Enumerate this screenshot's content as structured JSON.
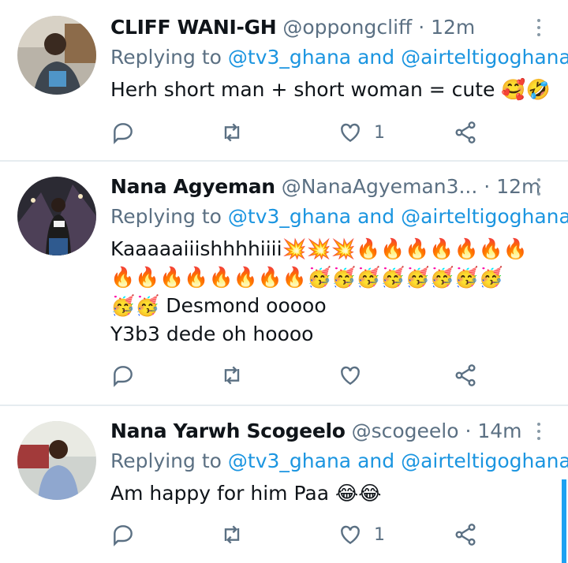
{
  "tweets": [
    {
      "name": "CLIFF WANI-GH",
      "handle": "@oppongcliff",
      "dot": "·",
      "time": "12m",
      "replying_prefix": "Replying to",
      "mention1": "@tv3_ghana",
      "and_word": "and",
      "mention2": "@airteltigoghana",
      "lines": [
        "Herh short man + short woman = cute 🥰🤣"
      ],
      "like_count": "1"
    },
    {
      "name": "Nana Agyeman",
      "handle": "@NanaAgyeman3...",
      "dot": "·",
      "time": "12m",
      "replying_prefix": "Replying to",
      "mention1": "@tv3_ghana",
      "and_word": "and",
      "mention2": "@airteltigoghana",
      "lines": [
        "Kaaaaaiiishhhhiiii💥💥💥🔥🔥🔥🔥🔥🔥🔥",
        "🔥🔥🔥🔥🔥🔥🔥🔥🥳🥳🥳🥳🥳🥳🥳🥳",
        "🥳🥳 Desmond ooooo",
        "Y3b3 dede oh hoooo"
      ],
      "like_count": ""
    },
    {
      "name": "Nana Yarwh Scogeelo",
      "handle": "@scogeelo",
      "dot": "·",
      "time": "14m",
      "replying_prefix": "Replying to",
      "mention1": "@tv3_ghana",
      "and_word": "and",
      "mention2": "@airteltigoghana",
      "lines": [
        "Am happy for him Paa 😂😂"
      ],
      "like_count": "1"
    }
  ],
  "icons": {
    "reply": "reply-icon",
    "retweet": "retweet-icon",
    "like": "heart-icon",
    "share": "share-icon",
    "more": "more-vertical-icon"
  },
  "colors": {
    "accent": "#1b95e0",
    "secondary_text": "#5b7083",
    "divider": "#e6ecf0"
  }
}
